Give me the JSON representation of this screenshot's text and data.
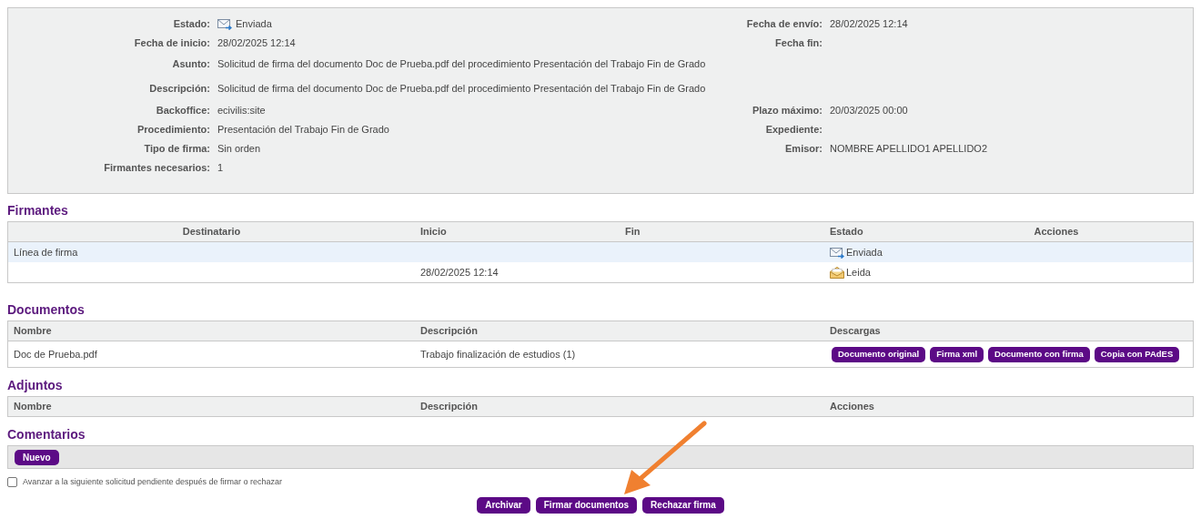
{
  "details": [
    {
      "left": {
        "label": "Estado:",
        "value": "Enviada",
        "kind": "sent"
      },
      "right": {
        "label": "Fecha de envío:",
        "value": "28/02/2025 12:14"
      }
    },
    {
      "left": {
        "label": "Fecha de inicio:",
        "value": "28/02/2025 12:14"
      },
      "right": {
        "label": "Fecha fin:"
      }
    },
    {
      "left": {
        "label": "Asunto:",
        "value": "Solicitud de firma del documento Doc de Prueba.pdf del procedimiento Presentación del Trabajo Fin de Grado"
      }
    },
    {
      "left": {
        "label": "Descripción:",
        "value": "Solicitud de firma del documento Doc de Prueba.pdf del procedimiento Presentación del Trabajo Fin de Grado"
      }
    },
    {
      "left": {
        "label": "Backoffice:",
        "value": "ecivilis:site"
      },
      "right": {
        "label": "Plazo máximo:",
        "value": "20/03/2025 00:00"
      }
    },
    {
      "left": {
        "label": "Procedimiento:",
        "value": "Presentación del Trabajo Fin de Grado"
      },
      "right": {
        "label": "Expediente:"
      }
    },
    {
      "left": {
        "label": "Tipo de firma:",
        "value": "Sin orden"
      },
      "right": {
        "label": "Emisor:",
        "value": "NOMBRE APELLIDO1 APELLIDO2"
      }
    },
    {
      "left": {
        "label": "Firmantes necesarios:",
        "value": "1"
      }
    }
  ],
  "firmantes": {
    "title": "Firmantes",
    "columns": [
      "Destinatario",
      "Inicio",
      "Fin",
      "Estado",
      "Acciones"
    ],
    "rows": [
      {
        "kind": "group",
        "label": "Línea de firma",
        "estado": {
          "kind": "sent",
          "text": "Enviada"
        }
      },
      {
        "kind": "signer",
        "inicio": "28/02/2025 12:14",
        "estado": {
          "kind": "read",
          "text": "Leida"
        }
      }
    ]
  },
  "documentos": {
    "title": "Documentos",
    "columns": [
      "Nombre",
      "Descripción",
      "Descargas"
    ],
    "rows": [
      {
        "nombre": "Doc de Prueba.pdf",
        "descripcion": "Trabajo finalización de estudios (1)",
        "buttons": [
          "Documento original",
          "Firma xml",
          "Documento con firma",
          "Copia con PAdES"
        ]
      }
    ]
  },
  "adjuntos": {
    "title": "Adjuntos",
    "columns": [
      "Nombre",
      "Descripción",
      "Acciones"
    ]
  },
  "comentarios": {
    "title": "Comentarios",
    "button": "Nuevo"
  },
  "advance_option": {
    "label": "Avanzar a la siguiente solicitud pendiente después de firmar o rechazar",
    "checked": false
  },
  "actions": [
    "Archivar",
    "Firmar documentos",
    "Rechazar firma"
  ]
}
